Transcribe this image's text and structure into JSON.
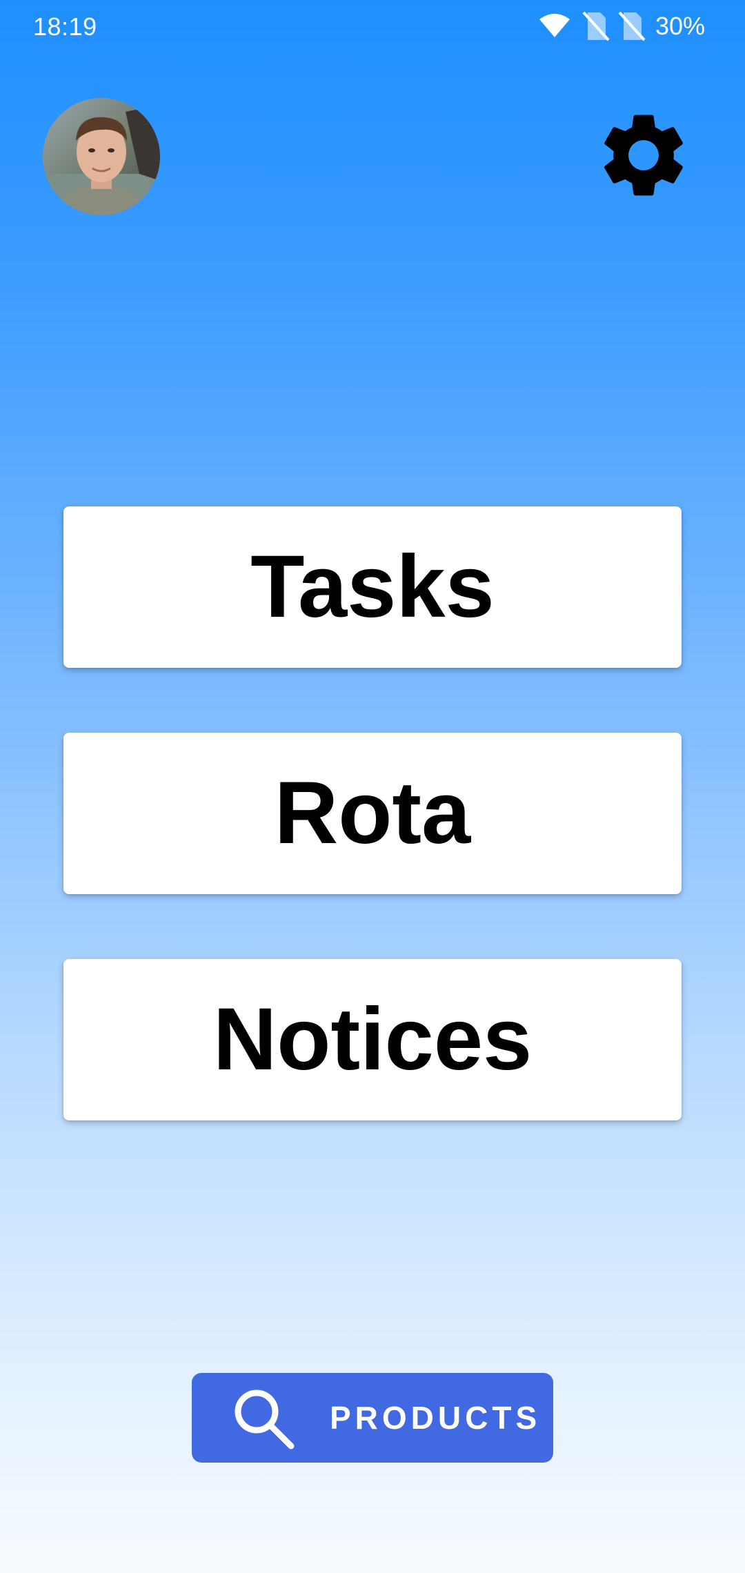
{
  "status_bar": {
    "time": "18:19",
    "battery": "30%",
    "icons": [
      "wifi-icon",
      "no-sim-icon",
      "no-sim-icon"
    ]
  },
  "header": {
    "avatar": "profile-photo",
    "settings_icon": "gear-icon"
  },
  "menu": {
    "items": [
      {
        "label": "Tasks"
      },
      {
        "label": "Rota"
      },
      {
        "label": "Notices"
      }
    ]
  },
  "products_button": {
    "label": "PRODUCTS",
    "icon": "search-icon",
    "color": "#4169e1"
  },
  "colors": {
    "gradient_top": "#1e8fff",
    "gradient_bottom": "#f7fbff",
    "button_bg": "#ffffff"
  }
}
